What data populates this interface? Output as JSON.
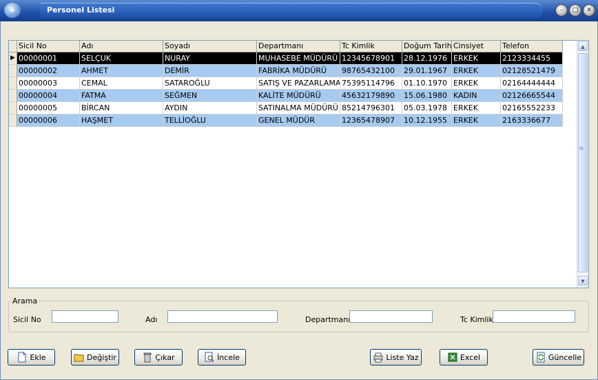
{
  "window": {
    "title": "Personel Listesi"
  },
  "grid": {
    "columns": [
      "Sicil No",
      "Adı",
      "Soyadı",
      "Departmanı",
      "Tc Kimlik",
      "Doğum Tarihi",
      "Cinsiyet",
      "Telefon"
    ],
    "rows": [
      [
        "00000001",
        "SELÇUK",
        "NURAY",
        "MUHASEBE MÜDÜRÜ",
        "12345678901",
        "28.12.1976",
        "ERKEK",
        "2123334455"
      ],
      [
        "00000002",
        "AHMET",
        "DEMİR",
        "FABRİKA MÜDÜRÜ",
        "98765432100",
        "29.01.1967",
        "ERKEK",
        "02128521479"
      ],
      [
        "00000003",
        "CEMAL",
        "SATAROĞLU",
        "SATIŞ VE PAZARLAMA",
        "75395114796",
        "01.10.1970",
        "ERKEK",
        "02164444444"
      ],
      [
        "00000004",
        "FATMA",
        "SEĞMEN",
        "KALİTE MÜDÜRÜ",
        "45632179890",
        "15.06.1980",
        "KADIN",
        "02126665544"
      ],
      [
        "00000005",
        "BİRCAN",
        "AYDIN",
        "SATINALMA MÜDÜRÜ",
        "85214796301",
        "05.03.1978",
        "ERKEK",
        "02165552233"
      ],
      [
        "00000006",
        "HAŞMET",
        "TELLİOĞLU",
        "GENEL MÜDÜR",
        "12365478907",
        "10.12.1955",
        "ERKEK",
        "2163336677"
      ]
    ],
    "selected_row": 0,
    "colors": {
      "selected_bg": "#000000",
      "alt_bg": "#a6caf0",
      "normal_bg": "#ffffff"
    }
  },
  "search": {
    "group_label": "Arama",
    "sicil_label": "Sicil No",
    "sicil_value": "",
    "adi_label": "Adı",
    "adi_value": "",
    "departman_label": "Departmanı",
    "departman_value": "",
    "tc_label": "Tc Kimlik",
    "tc_value": ""
  },
  "buttons": {
    "ekle": "Ekle",
    "degistir": "Değiştir",
    "cikar": "Çıkar",
    "incele": "İncele",
    "liste_yaz": "Liste Yaz",
    "excel": "Excel",
    "guncelle": "Güncelle"
  }
}
